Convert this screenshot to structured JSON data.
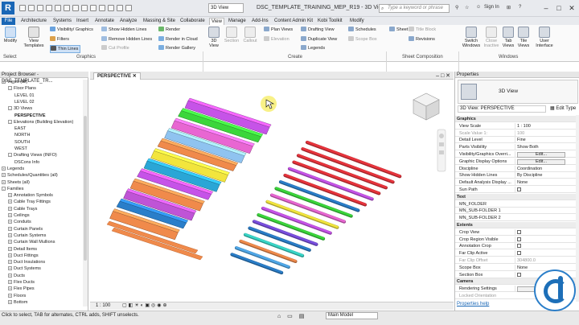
{
  "titlebar": {
    "logo": "R",
    "view_dropdown": "3D View",
    "document_title": "DSC_TEMPLATE_TRAINING_MEP_R19 - 3D View:...",
    "search_placeholder": "Type a keyword or phrase",
    "sign_in": "Sign In"
  },
  "menu_tabs": [
    "File",
    "Architecture",
    "Systems",
    "Insert",
    "Annotate",
    "Analyze",
    "Massing & Site",
    "Collaborate",
    "View",
    "Manage",
    "Add-Ins",
    "Content Admin Kit",
    "Kobi Toolkit",
    "Modify"
  ],
  "active_tab": "View",
  "ribbon": {
    "modify": "Modify",
    "select": "Select",
    "view_templates": "View Templates",
    "visibility": "Visibility/ Graphics",
    "filters": "Filters",
    "thin_lines": "Thin Lines",
    "show_hidden": "Show Hidden Lines",
    "remove_hidden": "Remove Hidden Lines",
    "cut_profile": "Cut Profile",
    "render": "Render",
    "render_cloud": "Render in Cloud",
    "render_gallery": "Render Gallery",
    "group_graphics": "Graphics",
    "view_3d": "3D View",
    "section": "Section",
    "callout": "Callout",
    "plan_views": "Plan Views",
    "elevation": "Elevation",
    "drafting_view": "Drafting View",
    "duplicate_view": "Duplicate View",
    "legends": "Legends",
    "schedules": "Schedules",
    "scope_box": "Scope Box",
    "group_create": "Create",
    "sheet": "Sheet",
    "title_block": "Title Block",
    "revisions": "Revisions",
    "group_sheet": "Sheet Composition",
    "switch_windows": "Switch Windows",
    "close_inactive": "Close Inactive",
    "tab_views": "Tab Views",
    "tile_views": "Tile Views",
    "user_interface": "User Interface",
    "group_windows": "Windows"
  },
  "project_browser": {
    "header": "Project Browser - DSC_TEMPLATE_TR...",
    "items": [
      {
        "label": "Views (all)",
        "level": 0,
        "toggle": "-"
      },
      {
        "label": "Floor Plans",
        "level": 1,
        "toggle": "-"
      },
      {
        "label": "LEVEL 01",
        "level": 2,
        "toggle": ""
      },
      {
        "label": "LEVEL 02",
        "level": 2,
        "toggle": ""
      },
      {
        "label": "3D Views",
        "level": 1,
        "toggle": "-"
      },
      {
        "label": "PERSPECTIVE",
        "level": 2,
        "toggle": "",
        "selected": true
      },
      {
        "label": "Elevations (Building Elevation)",
        "level": 1,
        "toggle": "-"
      },
      {
        "label": "EAST",
        "level": 2,
        "toggle": ""
      },
      {
        "label": "NORTH",
        "level": 2,
        "toggle": ""
      },
      {
        "label": "SOUTH",
        "level": 2,
        "toggle": ""
      },
      {
        "label": "WEST",
        "level": 2,
        "toggle": ""
      },
      {
        "label": "Drafting Views (INFO)",
        "level": 1,
        "toggle": "-"
      },
      {
        "label": "DSCons Info",
        "level": 2,
        "toggle": ""
      },
      {
        "label": "Legends",
        "level": 0,
        "toggle": "+"
      },
      {
        "label": "Schedules/Quantities (all)",
        "level": 0,
        "toggle": "+"
      },
      {
        "label": "Sheets (all)",
        "level": 0,
        "toggle": "+"
      },
      {
        "label": "Families",
        "level": 0,
        "toggle": "-"
      },
      {
        "label": "Annotation Symbols",
        "level": 1,
        "toggle": "+"
      },
      {
        "label": "Cable Tray Fittings",
        "level": 1,
        "toggle": "+"
      },
      {
        "label": "Cable Trays",
        "level": 1,
        "toggle": "+"
      },
      {
        "label": "Ceilings",
        "level": 1,
        "toggle": "+"
      },
      {
        "label": "Conduits",
        "level": 1,
        "toggle": "+"
      },
      {
        "label": "Curtain Panels",
        "level": 1,
        "toggle": "+"
      },
      {
        "label": "Curtain Systems",
        "level": 1,
        "toggle": "+"
      },
      {
        "label": "Curtain Wall Mullions",
        "level": 1,
        "toggle": "+"
      },
      {
        "label": "Detail Items",
        "level": 1,
        "toggle": "+"
      },
      {
        "label": "Duct Fittings",
        "level": 1,
        "toggle": "+"
      },
      {
        "label": "Duct Insulations",
        "level": 1,
        "toggle": "+"
      },
      {
        "label": "Duct Systems",
        "level": 1,
        "toggle": "+"
      },
      {
        "label": "Ducts",
        "level": 1,
        "toggle": "+"
      },
      {
        "label": "Flex Ducts",
        "level": 1,
        "toggle": "+"
      },
      {
        "label": "Flex Pipes",
        "level": 1,
        "toggle": "+"
      },
      {
        "label": "Floors",
        "level": 1,
        "toggle": "+"
      },
      {
        "label": "Bottom",
        "level": 1,
        "toggle": "+"
      }
    ]
  },
  "view_tab": "PERSPECTIVE",
  "view_scale": "1 : 100",
  "properties": {
    "header": "Properties",
    "type_name": "3D View",
    "selector": "3D View: PERSPECTIVE",
    "edit_type": "Edit Type",
    "rows": [
      {
        "k": "Graphics",
        "sec": true
      },
      {
        "k": "View Scale",
        "v": "1 : 100"
      },
      {
        "k": "Scale Value    1:",
        "v": "100",
        "dim": true
      },
      {
        "k": "Detail Level",
        "v": "Fine"
      },
      {
        "k": "Parts Visibility",
        "v": "Show Both"
      },
      {
        "k": "Visibility/Graphics Overri...",
        "v": "Edit...",
        "btn": true
      },
      {
        "k": "Graphic Display Options",
        "v": "Edit...",
        "btn": true
      },
      {
        "k": "Discipline",
        "v": "Coordination"
      },
      {
        "k": "Show Hidden Lines",
        "v": "By Discipline"
      },
      {
        "k": "Default Analysis Display ...",
        "v": "None"
      },
      {
        "k": "Sun Path",
        "v": "",
        "cb": true
      },
      {
        "k": "Text",
        "sec": true
      },
      {
        "k": "MN_FOLDER",
        "v": ""
      },
      {
        "k": "MN_SUB-FOLDER 1",
        "v": ""
      },
      {
        "k": "MN_SUB-FOLDER 2",
        "v": ""
      },
      {
        "k": "Extents",
        "sec": true
      },
      {
        "k": "Crop View",
        "v": "",
        "cb": true
      },
      {
        "k": "Crop Region Visible",
        "v": "",
        "cb": true
      },
      {
        "k": "Annotation Crop",
        "v": "",
        "cb": true
      },
      {
        "k": "Far Clip Active",
        "v": "",
        "cb": true
      },
      {
        "k": "Far Clip Offset",
        "v": "304800.0",
        "dim": true
      },
      {
        "k": "Scope Box",
        "v": "None"
      },
      {
        "k": "Section Box",
        "v": "",
        "cb": true
      },
      {
        "k": "Camera",
        "sec": true
      },
      {
        "k": "Rendering Settings",
        "v": "Edit...",
        "btn": true
      },
      {
        "k": "Locked Orientation",
        "v": "",
        "dim": true
      }
    ],
    "help": "Properties help"
  },
  "status": {
    "text": "Click to select, TAB for alternates, CTRL adds, SHIFT unselects.",
    "model": "Main Model"
  },
  "colors": {
    "accent": "#1a67b6",
    "left_ducts": [
      "#c653e8",
      "#3bd63b",
      "#e866d2",
      "#8fc3f0",
      "#f08a4b",
      "#f2e53d",
      "#2aa6d6",
      "#c653e8",
      "#f08a4b",
      "#bf54d6",
      "#2a7ec9",
      "#f08a4b"
    ],
    "right_pipes": [
      "#e8343c",
      "#e8343c",
      "#e8343c",
      "#e8343c",
      "#c653e8",
      "#e8343c",
      "#2a7ec9",
      "#3bd63b",
      "#e866d2",
      "#f2e53d",
      "#c653e8",
      "#3bd63b",
      "#7a4fe0",
      "#2a7ec9",
      "#39d6c8",
      "#f08a4b",
      "#4fa7e8",
      "#2a7ec9"
    ]
  }
}
